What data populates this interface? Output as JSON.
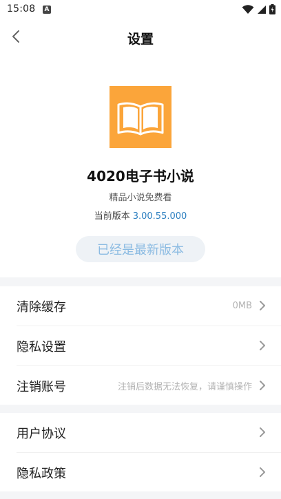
{
  "status_bar": {
    "time": "15:08",
    "notification_letter": "A"
  },
  "header": {
    "title": "设置"
  },
  "app": {
    "name": "4020电子书小说",
    "slogan": "精品小说免费看",
    "version_label": "当前版本",
    "version_number": "3.00.55.000",
    "logo_color": "#fba53a"
  },
  "update_status": "已经是最新版本",
  "settings_group1": [
    {
      "label": "清除缓存",
      "value": "0MB"
    },
    {
      "label": "隐私设置",
      "value": ""
    },
    {
      "label": "注销账号",
      "value": "注销后数据无法恢复，请谨慎操作"
    }
  ],
  "settings_group2": [
    {
      "label": "用户协议",
      "value": ""
    },
    {
      "label": "隐私政策",
      "value": ""
    }
  ],
  "colors": {
    "accent_blue": "#2c7fc0",
    "pill_text": "#8bbbe2",
    "section_gap": "#f4f5f7"
  }
}
